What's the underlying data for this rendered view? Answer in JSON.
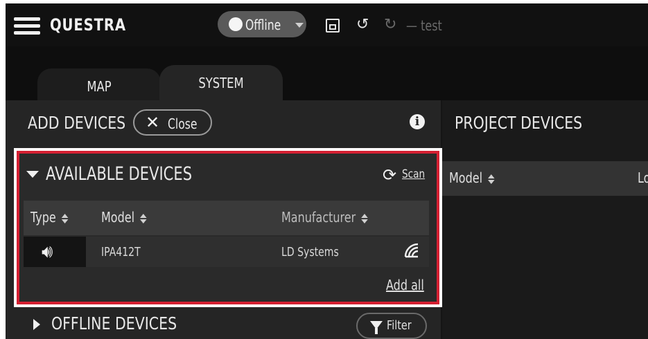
{
  "header": {
    "app_name": "QUESTRA",
    "status_label": "Offline",
    "project_name": "— test"
  },
  "tabs": [
    {
      "label": "MAP"
    },
    {
      "label": "SYSTEM"
    }
  ],
  "add_devices": {
    "title": "ADD DEVICES",
    "close_label": "Close",
    "info_icon": "info-icon"
  },
  "available_devices": {
    "title": "AVAILABLE DEVICES",
    "scan_label": "Scan",
    "columns": [
      "Type",
      "Model",
      "Manufacturer"
    ],
    "rows": [
      {
        "type_icon": "speaker-icon",
        "model": "IPA412T",
        "manufacturer": "LD Systems"
      }
    ],
    "add_all_label": "Add all"
  },
  "offline_devices": {
    "title": "OFFLINE DEVICES",
    "filter_label": "Filter"
  },
  "project_devices": {
    "title": "PROJECT DEVICES",
    "columns": [
      "Model",
      "Lo"
    ]
  },
  "colors": {
    "highlight": "#d42032",
    "panel": "#252525",
    "background": "#151515"
  }
}
